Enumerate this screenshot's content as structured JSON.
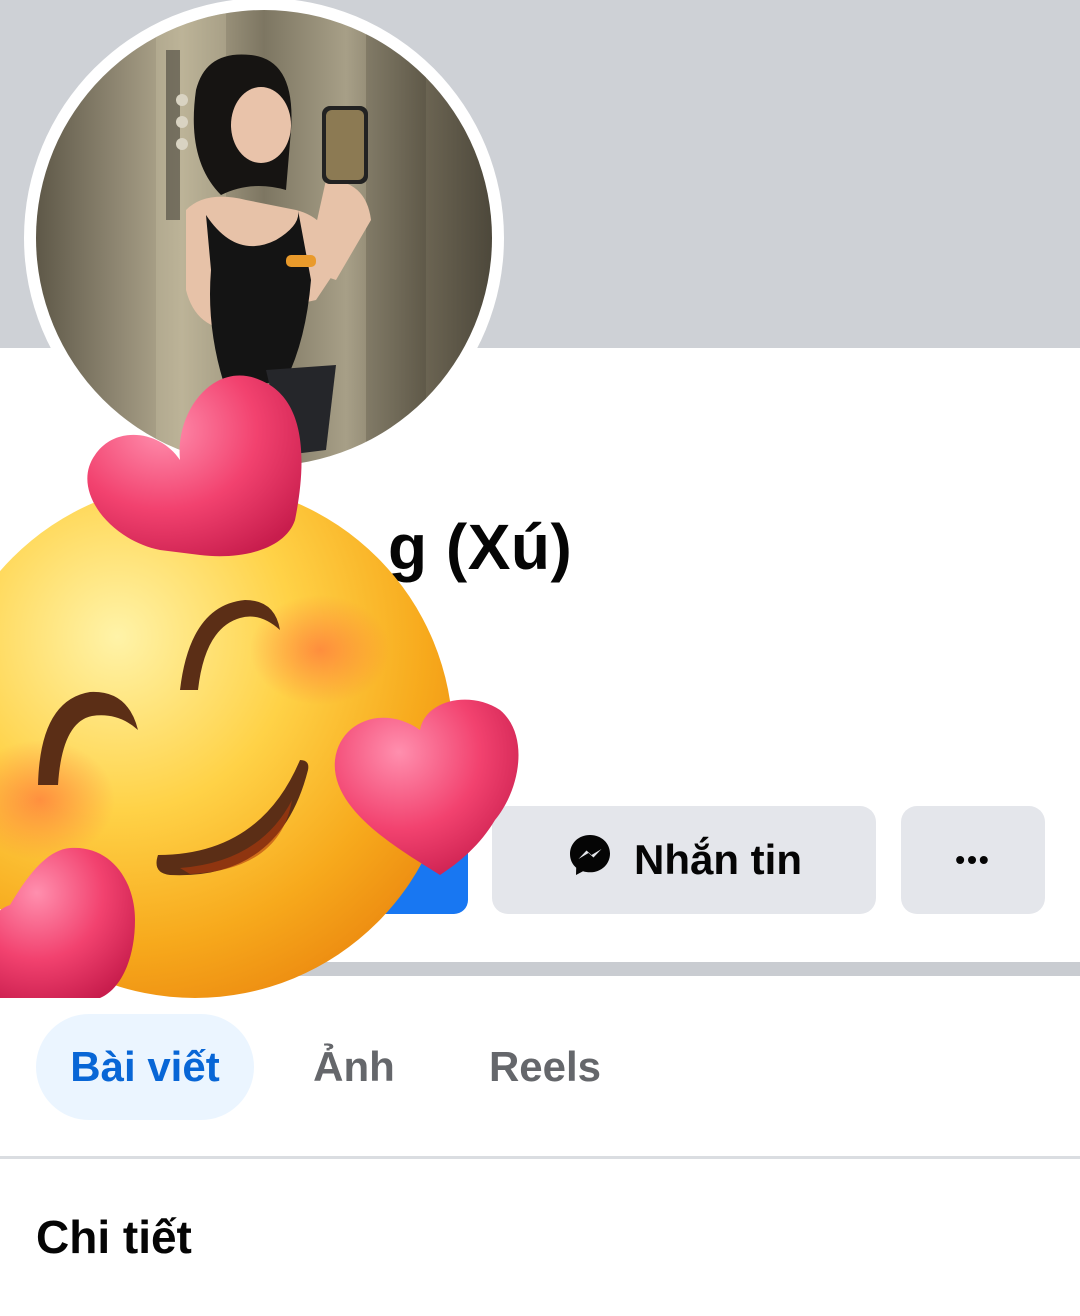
{
  "profile": {
    "name_visible": "g (Xú)"
  },
  "actions": {
    "message_label": "Nhắn tin",
    "more_label": "•••"
  },
  "tabs": [
    {
      "label": "Bài viết",
      "active": true
    },
    {
      "label": "Ảnh",
      "active": false
    },
    {
      "label": "Reels",
      "active": false
    }
  ],
  "section": {
    "title": "Chi tiết"
  },
  "icons": {
    "message": "messenger-icon",
    "more": "more-dots-icon",
    "sticker": "smiling-face-with-hearts-icon"
  },
  "colors": {
    "cover": "#ced1d6",
    "primary": "#1877f2",
    "secondary_button": "#e4e6eb",
    "active_tab_bg": "#ebf5ff",
    "active_tab_text": "#0866d6",
    "inactive_tab_text": "#65676b",
    "text": "#050505"
  }
}
